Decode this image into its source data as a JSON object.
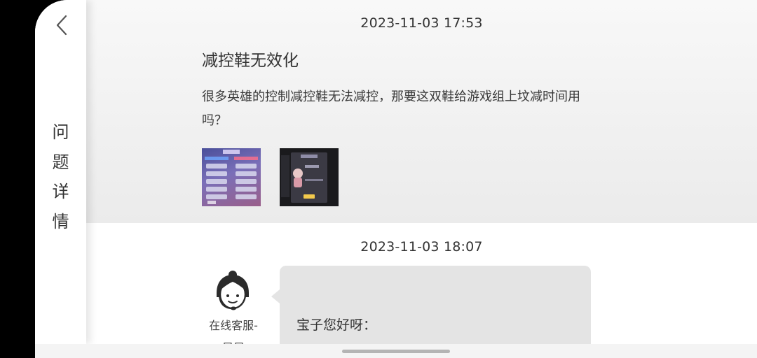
{
  "sidebar": {
    "title_chars": [
      "问",
      "题",
      "详",
      "情"
    ],
    "back_icon": "chevron-left-icon"
  },
  "question": {
    "timestamp": "2023-11-03 17:53",
    "title": "减控鞋无效化",
    "body": "很多英雄的控制减控鞋无法减控，那要这双鞋给游戏组上坟减时间用吗？",
    "attachments": [
      "game-screenshot-scoreboard",
      "game-screenshot-dialog"
    ]
  },
  "reply": {
    "timestamp": "2023-11-03 18:07",
    "agent_name": "在线客服-",
    "agent_name_line2": "早早",
    "greeting": "宝子您好呀："
  },
  "colors": {
    "question_bg": "#f3f3f3",
    "bubble_bg": "#e4e4e4",
    "text": "#333333"
  }
}
